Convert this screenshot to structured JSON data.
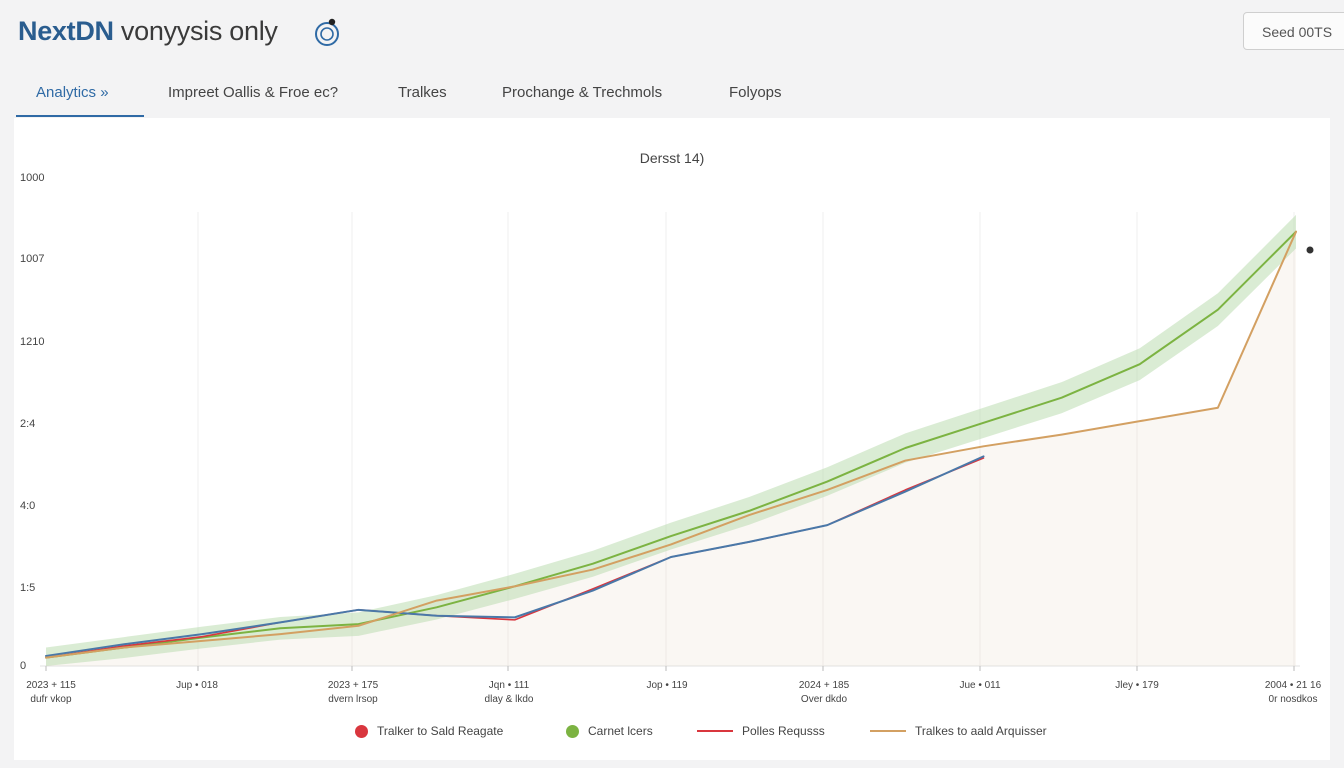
{
  "app": {
    "brand_name": "NextDN",
    "brand_suffix": " vonyysis only",
    "send_button_label": "Seed 00TS"
  },
  "tabs": [
    {
      "label": "Analytics »",
      "active": true
    },
    {
      "label": "Impreet Oallis & Froe ec?",
      "active": false
    },
    {
      "label": "Tralkes",
      "active": false
    },
    {
      "label": "Prochange & Trechmols",
      "active": false
    },
    {
      "label": "Folyops",
      "active": false
    }
  ],
  "colors": {
    "accent": "#2f6aa5",
    "series_blue": "#4a78a8",
    "series_orange": "#d3a062",
    "series_green": "#7cb342",
    "series_red": "#d9363e",
    "band_green": "#bcdcb0",
    "band_beige": "#e8dcc8"
  },
  "chart_data": {
    "type": "line",
    "title": "Dersst 14)",
    "y_ticks": [
      "1000",
      "1007",
      "1210",
      "2:4",
      "4:0",
      "1:5",
      "0"
    ],
    "x_ticks": [
      {
        "line1": "2023 + 115",
        "line2": "dufr vkop"
      },
      {
        "line1": "Jup • 018",
        "line2": ""
      },
      {
        "line1": "2023 + 175",
        "line2": "dvern lrsop"
      },
      {
        "line1": "Jqn • 111",
        "line2": "dlay & lkdo"
      },
      {
        "line1": "Jop • 119",
        "line2": ""
      },
      {
        "line1": "2024 + 185",
        "line2": "Over dkdo"
      },
      {
        "line1": "Jue • 011",
        "line2": ""
      },
      {
        "line1": "Jley • 179",
        "line2": ""
      },
      {
        "line1": "2004 • 21 16",
        "line2": "0r nosdkos"
      }
    ],
    "series": [
      {
        "name": "Tralkes to aald Arquisser",
        "color": "#d3a062",
        "values": [
          0.1,
          0.22,
          0.3,
          0.38,
          0.48,
          0.78,
          0.95,
          1.15,
          1.45,
          1.8,
          2.1,
          2.45,
          2.62,
          2.76,
          2.92,
          3.08,
          5.18
        ]
      },
      {
        "name": "Carnet lcers",
        "color": "#7cb342",
        "values": [
          0.1,
          0.22,
          0.34,
          0.45,
          0.5,
          0.7,
          0.95,
          1.22,
          1.55,
          1.85,
          2.2,
          2.6,
          2.9,
          3.2,
          3.6,
          4.25,
          5.18
        ]
      },
      {
        "name": "Polles Requsss",
        "color": "#d9363e",
        "values": [
          0.1,
          0.24,
          0.35,
          0.52,
          0.67,
          0.6,
          0.55,
          0.92,
          1.3,
          1.48,
          1.68,
          2.1,
          2.48
        ]
      },
      {
        "name": "Tralker to Sald Reagate",
        "color": "#4a78a8",
        "values": [
          0.12,
          0.26,
          0.38,
          0.52,
          0.67,
          0.6,
          0.58,
          0.9,
          1.3,
          1.48,
          1.68,
          2.08,
          2.5
        ]
      }
    ],
    "legend": [
      {
        "label": "Tralker to Sald Reagate",
        "marker": "dot",
        "color": "#d9363e"
      },
      {
        "label": "Carnet lcers",
        "marker": "dot",
        "color": "#7cb342"
      },
      {
        "label": "Polles Requsss",
        "marker": "line",
        "color": "#d9363e"
      },
      {
        "label": "Tralkes to aald Arquisser",
        "marker": "line",
        "color": "#d3a062"
      }
    ],
    "legend_position": "bottom-center",
    "grid": true
  }
}
